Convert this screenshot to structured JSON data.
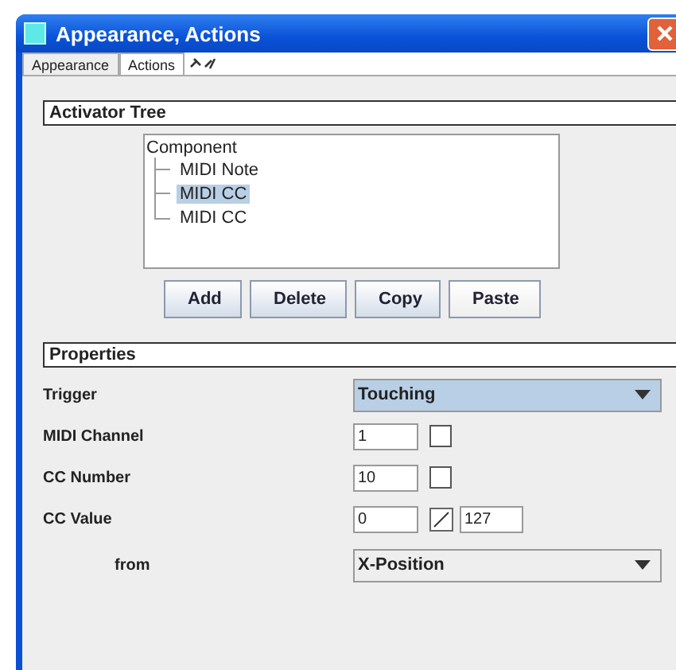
{
  "window": {
    "title": "Appearance, Actions"
  },
  "tabs": [
    {
      "label": "Appearance",
      "selected": false
    },
    {
      "label": "Actions",
      "selected": true
    }
  ],
  "activator_tree": {
    "title": "Activator Tree",
    "root": "Component",
    "children": [
      {
        "label": "MIDI Note",
        "selected": false
      },
      {
        "label": "MIDI CC",
        "selected": true
      },
      {
        "label": "MIDI CC",
        "selected": false
      }
    ]
  },
  "buttons": [
    "Add",
    "Delete",
    "Copy",
    "Paste"
  ],
  "properties": {
    "title": "Properties",
    "rows": [
      {
        "kind": "dropdown",
        "label": "Trigger",
        "value": "Touching",
        "focused": true
      },
      {
        "kind": "field-check",
        "label": "MIDI Channel",
        "value": "1",
        "checked": false
      },
      {
        "kind": "field-check",
        "label": "CC Number",
        "value": "10",
        "checked": false
      },
      {
        "kind": "range",
        "label": "CC Value",
        "value": "0",
        "value_2": "127"
      },
      {
        "kind": "dropdown",
        "label": "from",
        "value": "X-Position",
        "focused": false,
        "indented": true
      }
    ]
  }
}
